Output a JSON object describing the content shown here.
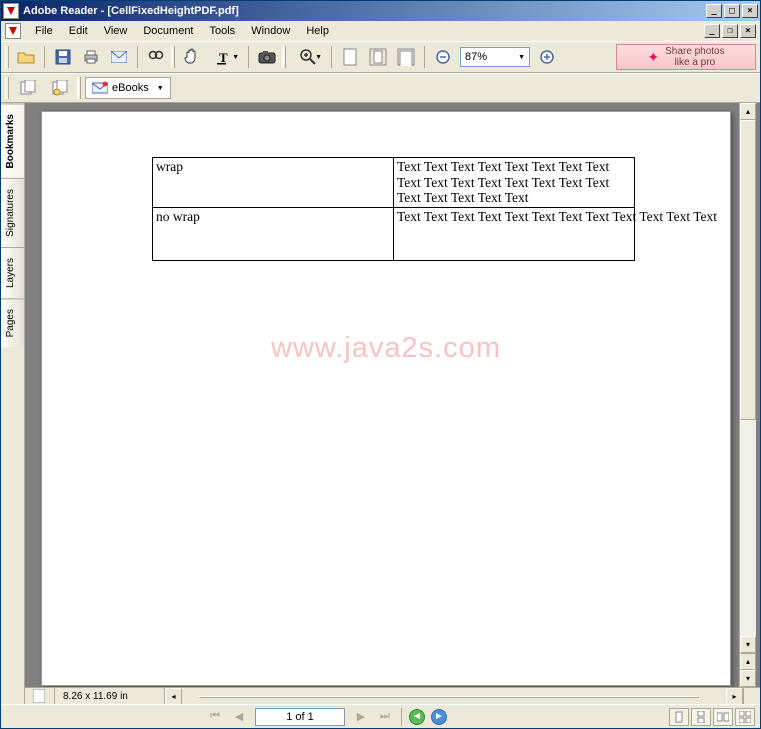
{
  "window": {
    "title": "Adobe Reader - [CellFixedHeightPDF.pdf]"
  },
  "menus": {
    "file": "File",
    "edit": "Edit",
    "view": "View",
    "document": "Document",
    "tools": "Tools",
    "window": "Window",
    "help": "Help"
  },
  "toolbar": {
    "zoom_value": "87%",
    "promo_line1": "Share photos",
    "promo_line2": "like a pro",
    "ebooks_label": "eBooks"
  },
  "sidebar": {
    "tabs": {
      "bookmarks": "Bookmarks",
      "signatures": "Signatures",
      "layers": "Layers",
      "pages": "Pages"
    }
  },
  "document": {
    "watermark": "www.java2s.com",
    "table": {
      "r1c1": "wrap",
      "r1c2": "Text Text Text Text Text Text Text Text Text Text Text Text Text Text Text Text Text Text Text Text Text",
      "r2c1": "no wrap",
      "r2c2": "Text Text Text Text Text Text Text Text Text Text Text Text"
    }
  },
  "status": {
    "page_size": "8.26 x 11.69 in",
    "page_of": "1 of 1"
  }
}
